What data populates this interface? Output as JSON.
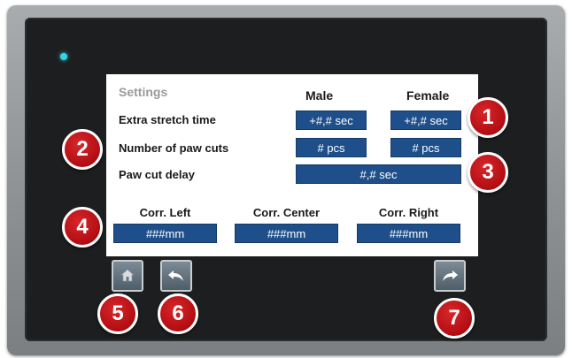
{
  "screen": {
    "title": "Settings",
    "columns": {
      "male": "Male",
      "female": "Female"
    },
    "rows": {
      "extra_stretch": {
        "label": "Extra stretch time",
        "male_value": "+#,# sec",
        "female_value": "+#,# sec"
      },
      "paw_cuts": {
        "label": "Number of paw cuts",
        "male_value": "# pcs",
        "female_value": "# pcs"
      },
      "paw_cut_delay": {
        "label": "Paw cut delay",
        "value": "#,# sec"
      }
    },
    "corrections": {
      "left": {
        "label": "Corr. Left",
        "value": "###mm"
      },
      "center": {
        "label": "Corr. Center",
        "value": "###mm"
      },
      "right": {
        "label": "Corr. Right",
        "value": "###mm"
      }
    }
  },
  "buttons": {
    "home_icon": "home-icon",
    "back_icon": "back-arrow-icon",
    "forward_icon": "forward-arrow-icon"
  },
  "badges": [
    "1",
    "2",
    "3",
    "4",
    "5",
    "6",
    "7"
  ],
  "colors": {
    "field_bg": "#1e4f8a",
    "badge_red": "#c0151a",
    "led": "#34d6e6"
  }
}
